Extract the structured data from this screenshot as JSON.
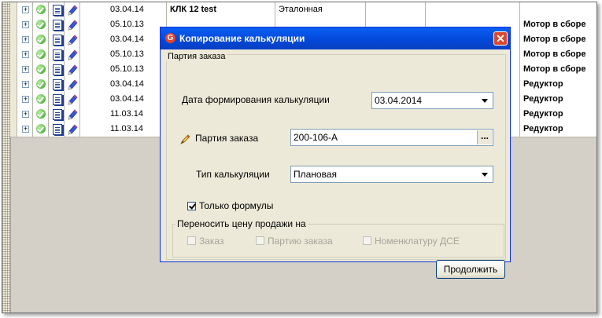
{
  "table": {
    "rows": [
      {
        "date": "03.04.14",
        "name": "КЛК 12 test",
        "type": "Эталонная",
        "product": ""
      },
      {
        "date": "05.10.13",
        "name": "",
        "type": "",
        "product": "Мотор в сборе"
      },
      {
        "date": "03.04.14",
        "name": "",
        "type": "",
        "product": "Мотор в сборе"
      },
      {
        "date": "05.10.13",
        "name": "",
        "type": "",
        "product": "Мотор в сборе"
      },
      {
        "date": "05.10.13",
        "name": "",
        "type": "",
        "product": "Мотор в сборе"
      },
      {
        "date": "03.04.14",
        "name": "",
        "type": "",
        "product": "Редуктор"
      },
      {
        "date": "03.04.14",
        "name": "",
        "type": "",
        "product": "Редуктор"
      },
      {
        "date": "11.03.14",
        "name": "",
        "type": "",
        "product": "Редуктор"
      },
      {
        "date": "11.03.14",
        "name": "",
        "type": "",
        "product": "Редуктор"
      }
    ],
    "expand_glyph": "+",
    "icons": [
      "expand-icon",
      "ok-check-icon",
      "document-icon",
      "edit-pen-icon"
    ]
  },
  "dialog": {
    "title": "Копирование калькуляции",
    "app_icon_letter": "G",
    "close_glyph": "✕",
    "group_order": "Партия заказа",
    "calc_date_label": "Дата формирования калькуляции",
    "calc_date_value": "03.04.2014",
    "order_batch_label": "Партия заказа",
    "order_batch_value": "200-106-А",
    "order_batch_button": "...",
    "calc_type_label": "Тип калькуляции",
    "calc_type_value": "Плановая",
    "only_formulas_label": "Только формулы",
    "only_formulas_checked": true,
    "transfer_group": "Переносить цену продажи на",
    "transfer_options": [
      {
        "label": "Заказ",
        "checked": false,
        "enabled": false
      },
      {
        "label": "Партию заказа",
        "checked": false,
        "enabled": false
      },
      {
        "label": "Номенклатуру ДСЕ",
        "checked": false,
        "enabled": false
      }
    ],
    "continue_button": "Продолжить"
  },
  "colors": {
    "titlebar": "#0348d8",
    "window_bg": "#ece9d8",
    "close_button": "#d9492f"
  }
}
